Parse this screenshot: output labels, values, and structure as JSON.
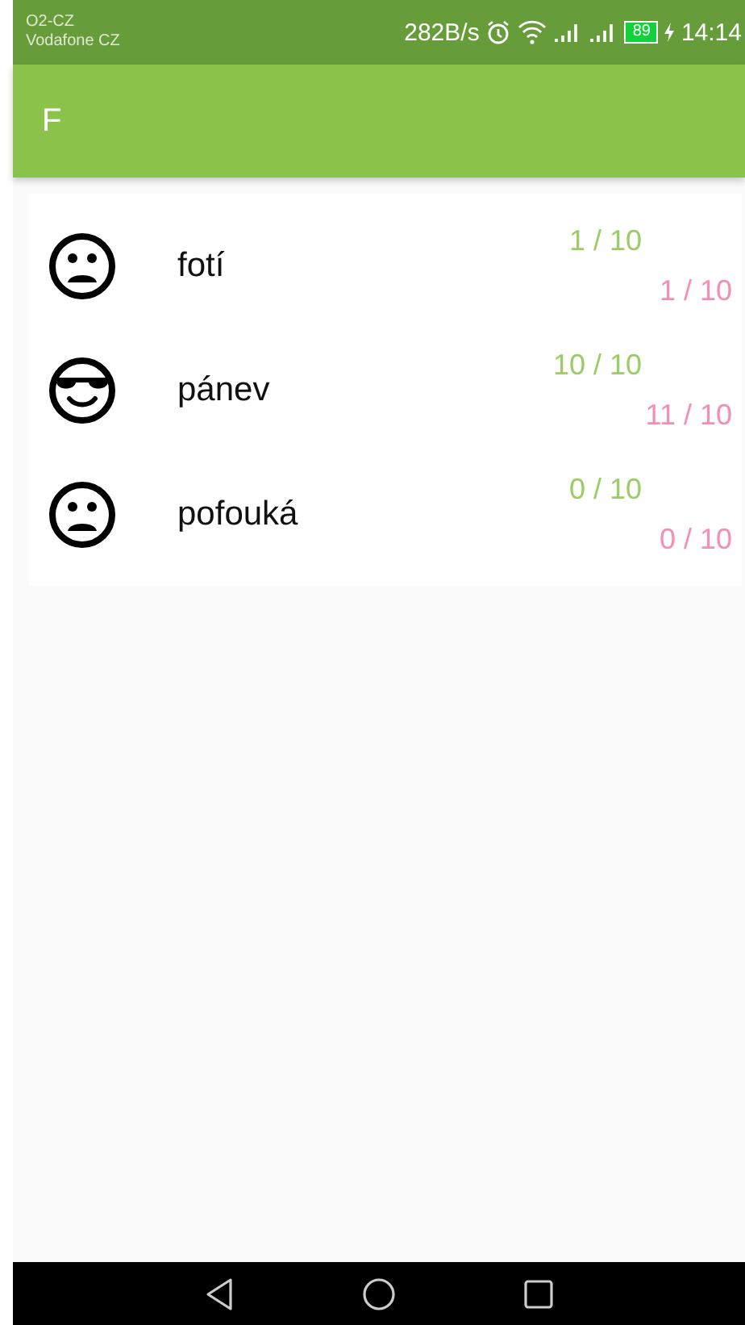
{
  "status_bar": {
    "carriers": [
      "O2-CZ",
      "Vodafone CZ"
    ],
    "speed": "282B/s",
    "battery": "89",
    "time": "14:14"
  },
  "app_bar": {
    "title": "F"
  },
  "items": [
    {
      "word": "fotí",
      "kind": "sad",
      "score_green": "1 / 10",
      "score_red": "1 / 10"
    },
    {
      "word": "pánev",
      "kind": "cool",
      "score_green": "10 / 10",
      "score_red": "11 / 10"
    },
    {
      "word": "pofouká",
      "kind": "sad",
      "score_green": "0 / 10",
      "score_red": "0 / 10"
    }
  ]
}
